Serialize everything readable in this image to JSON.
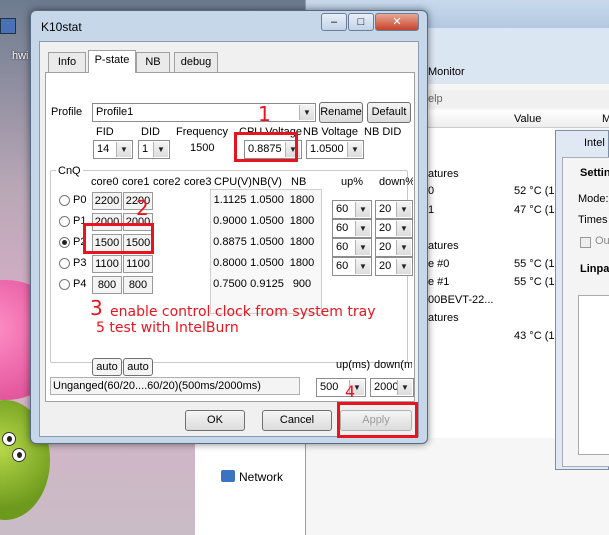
{
  "desktop": {
    "icon_label": "hwi"
  },
  "background_window": {
    "title": "Monitor",
    "menu_fragment": "elp",
    "column_value": "Value",
    "column_extra": "M",
    "rows": [
      {
        "label": "atures",
        "value": ""
      },
      {
        "label": "0",
        "value": "52 °C  (1"
      },
      {
        "label": "1",
        "value": "47 °C  (1"
      },
      {
        "label": "atures",
        "value": ""
      },
      {
        "label": "e #0",
        "value": "55 °C  (1"
      },
      {
        "label": "e #1",
        "value": "55 °C  (1"
      },
      {
        "label": "00BEVT-22...",
        "value": ""
      },
      {
        "label": "atures",
        "value": ""
      },
      {
        "label": "",
        "value": "43 °C  (1"
      }
    ],
    "explorer_item": "Network"
  },
  "side_window": {
    "title": "Intel",
    "group": "Settin",
    "mode_label": "Mode:",
    "times_label": "Times t",
    "checkbox_label": "Ou",
    "panel_label": "Linpa"
  },
  "k10": {
    "title": "K10stat",
    "tabs": [
      "Info",
      "P-state",
      "NB",
      "debug"
    ],
    "profile_label": "Profile",
    "profile_value": "Profile1",
    "rename_label": "Rename",
    "default_label": "Default",
    "headers": {
      "fid": "FID",
      "did": "DID",
      "frequency": "Frequency",
      "cpu_voltage": "CPU Voltage",
      "nb_voltage": "NB Voltage",
      "nb_did": "NB DID"
    },
    "fid_value": "14",
    "did_value": "1",
    "frequency_value": "1500",
    "cpu_voltage_value": "0.8875",
    "nb_voltage_value": "1.0500",
    "cnq_label": "CnQ",
    "core_headers": [
      "core0",
      "core1",
      "core2",
      "core3"
    ],
    "table_headers": {
      "cpu_v": "CPU(V)",
      "nb_v": "NB(V)",
      "nb": "NB",
      "up": "up%",
      "down": "down%"
    },
    "pstates": [
      {
        "name": "P0",
        "core0": "2200",
        "core1": "2200",
        "cpu_v": "1.1125",
        "nb_v": "1.0500",
        "nb": "1800",
        "up": "60",
        "down": "20",
        "checked": false
      },
      {
        "name": "P1",
        "core0": "2000",
        "core1": "2000",
        "cpu_v": "0.9000",
        "nb_v": "1.0500",
        "nb": "1800",
        "up": "60",
        "down": "20",
        "checked": false
      },
      {
        "name": "P2",
        "core0": "1500",
        "core1": "1500",
        "cpu_v": "0.8875",
        "nb_v": "1.0500",
        "nb": "1800",
        "up": "60",
        "down": "20",
        "checked": true
      },
      {
        "name": "P3",
        "core0": "1100",
        "core1": "1100",
        "cpu_v": "0.8000",
        "nb_v": "1.0500",
        "nb": "1800",
        "up": "60",
        "down": "20",
        "checked": false
      },
      {
        "name": "P4",
        "core0": "800",
        "core1": "800",
        "cpu_v": "0.7500",
        "nb_v": "0.9125",
        "nb": "900",
        "up": "",
        "down": "",
        "checked": false
      }
    ],
    "auto_label": "auto",
    "status_text": "Unganged(60/20....60/20)(500ms/2000ms)",
    "up_ms_label": "up(ms)",
    "down_ms_label": "down(ms",
    "up_ms_value": "500",
    "down_ms_value": "2000",
    "ok_label": "OK",
    "cancel_label": "Cancel",
    "apply_label": "Apply"
  },
  "annotations": {
    "n1": "1",
    "n2": "2",
    "n3": "3",
    "line3": "enable control clock from system tray",
    "line5": "5 test with IntelBurn",
    "n4": "4"
  },
  "colors": {
    "annotation_red": "#e8141e",
    "dialog_frame": "#c6d7ea"
  }
}
